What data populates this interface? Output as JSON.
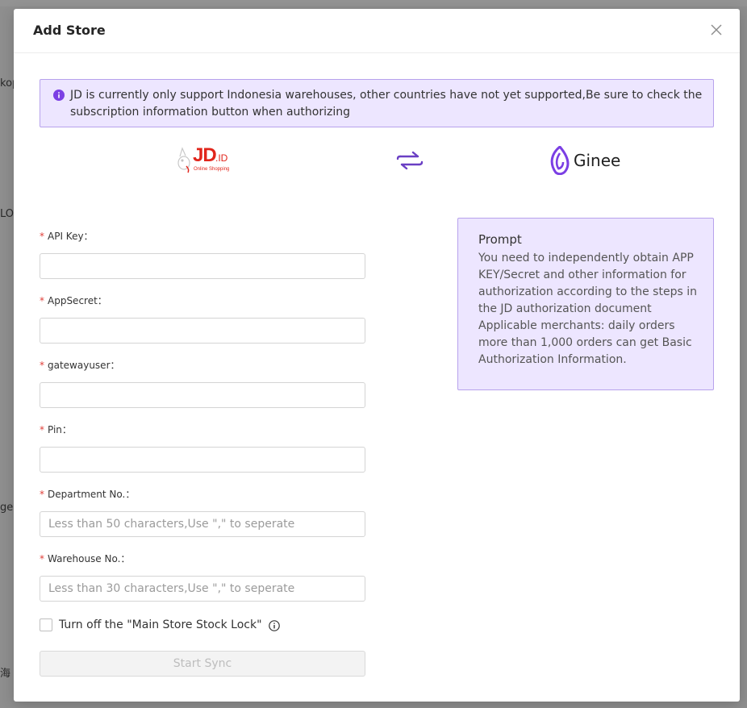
{
  "background": {
    "fragments": [
      "kop",
      "LO",
      "ge",
      "海"
    ]
  },
  "modal": {
    "title": "Add Store",
    "close_icon": "close-icon"
  },
  "notice": {
    "icon": "info-filled-icon",
    "text": "JD is currently only support Indonesia warehouses, other countries have not yet supported,Be sure to check the subscription information button when authorizing"
  },
  "logos": {
    "jd_text": "JD",
    "jd_suffix": ".ID",
    "jd_tagline": "Online Shopping",
    "sync_icon": "sync-arrows-icon",
    "ginee_text": "Ginee"
  },
  "form": {
    "required_mark": "*",
    "fields": [
      {
        "label": "API Key：",
        "value": "",
        "placeholder": ""
      },
      {
        "label": "AppSecret：",
        "value": "",
        "placeholder": ""
      },
      {
        "label": "gatewayuser：",
        "value": "",
        "placeholder": ""
      },
      {
        "label": "Pin：",
        "value": "",
        "placeholder": ""
      },
      {
        "label": "Department No.：",
        "value": "",
        "placeholder": "Less than 50 characters,Use \",\" to seperate"
      },
      {
        "label": "Warehouse No.：",
        "value": "",
        "placeholder": "Less than 30 characters,Use \",\" to seperate"
      }
    ],
    "checkbox_label": "Turn off the \"Main Store Stock Lock\"",
    "checkbox_checked": false,
    "submit_label": "Start Sync"
  },
  "prompt": {
    "title": "Prompt",
    "text": "You need to independently obtain APP KEY/Secret and other information for authorization according to the steps in the JD authorization document Applicable merchants: daily orders more than 1,000 orders can get Basic Authorization Information."
  },
  "colors": {
    "accent": "#7b3fe4",
    "notice_bg": "#ede6ff",
    "notice_border": "#b7a2ec",
    "required": "#e0403a",
    "jd_red": "#e1251b"
  }
}
